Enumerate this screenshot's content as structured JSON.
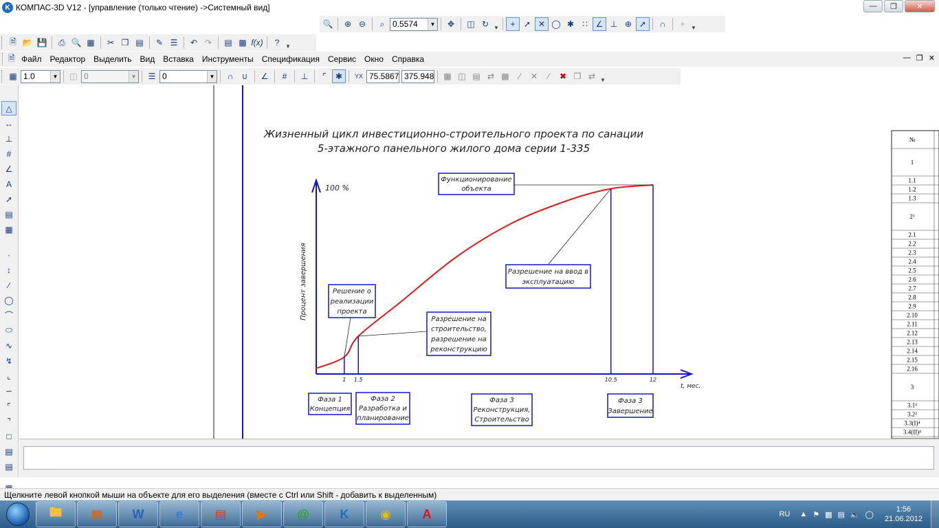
{
  "window": {
    "title": "КОМПАС-3D V12 - [управление (только чтение) ->Системный вид]",
    "controls": [
      "minimize-icon",
      "restore-icon",
      "close-icon"
    ]
  },
  "view_toolbar": {
    "zoom_value": "0.5574",
    "icons": [
      "zoom-window-icon",
      "zoom-in-icon",
      "zoom-out-icon",
      "zoom-scale-icon",
      "pan-icon",
      "refresh-icon",
      "redraw-icon"
    ]
  },
  "standard_toolbar": {
    "icons": [
      "new-file-icon",
      "open-file-icon",
      "save-icon",
      "print-icon",
      "print-preview-icon",
      "print-setup-icon",
      "cut-icon",
      "copy-icon",
      "paste-icon",
      "format-painter-icon",
      "properties-icon",
      "undo-icon",
      "redo-icon",
      "manager-icon",
      "library-icon",
      "variables-icon",
      "help-icon"
    ]
  },
  "menu": {
    "items": [
      "Файл",
      "Редактор",
      "Выделить",
      "Вид",
      "Вставка",
      "Инструменты",
      "Спецификация",
      "Сервис",
      "Окно",
      "Справка"
    ]
  },
  "current_params": {
    "scale_value": "1.0",
    "layer_value": "0",
    "style_value": "0",
    "coord_x": "75.5867",
    "coord_y": "375.948"
  },
  "drawing": {
    "title_line1": "Жизненный цикл инвестиционно-строительного проекта по санации",
    "title_line2": "5-этажного панельного жилого дома серии 1-335",
    "ylabel": "Процент завершения",
    "y_top_label": "100 %",
    "xlabel": "t, мес.",
    "x_ticks": [
      "1",
      "1.5",
      "10.5",
      "12"
    ],
    "callouts": [
      {
        "lines": [
          "Функционирование",
          "объекта"
        ]
      },
      {
        "lines": [
          "Решение о",
          "реализации",
          "проекта"
        ]
      },
      {
        "lines": [
          "Разрешение на",
          "строительство,",
          "разрешение на",
          "реконструкцию"
        ]
      },
      {
        "lines": [
          "Разрешение на ввод в",
          "эксплуатацию"
        ]
      }
    ],
    "phases": [
      {
        "lines": [
          "Фаза 1",
          "Концепция"
        ]
      },
      {
        "lines": [
          "Фаза 2",
          "Разработка и",
          "планирование"
        ]
      },
      {
        "lines": [
          "Фаза 3",
          "Реконструкция,",
          "Строительство"
        ]
      },
      {
        "lines": [
          "Фаза 3",
          "Завершение"
        ]
      }
    ],
    "curve_color": "#e01818",
    "frame_color": "#1414c8",
    "table_rows": [
      "№",
      "1",
      "1.1",
      "1.2",
      "1.3",
      "2¹",
      "2.1",
      "2.2",
      "2.3",
      "2.4",
      "2.5",
      "2.6",
      "2.7",
      "2.8",
      "2.9",
      "2.10",
      "2.11",
      "2.12",
      "2.13",
      "2.14",
      "2.15",
      "2.16",
      "3",
      "3.1²",
      "3.2²",
      "3.3(I)⁴",
      "3.4(II)²"
    ]
  },
  "chart_data": {
    "type": "line",
    "title": "Жизненный цикл инвестиционно-строительного проекта по санации 5-этажного панельного жилого дома серии 1-335",
    "xlabel": "t, мес.",
    "ylabel": "Процент завершения",
    "ylim": [
      0,
      100
    ],
    "series": [
      {
        "x": [
          0,
          1,
          1.5,
          3,
          5,
          7,
          9,
          10.5,
          12
        ],
        "y": [
          3,
          9,
          20,
          38,
          62,
          80,
          92,
          98,
          100
        ]
      }
    ]
  },
  "status": {
    "text": "Щелкните левой кнопкой мыши на объекте для его выделения (вместе с Ctrl или Shift - добавить к выделенным)"
  },
  "taskbar": {
    "apps": [
      "explorer-icon",
      "kompas-installer-icon",
      "word-icon",
      "ie-icon",
      "ppt-icon",
      "media-player-icon",
      "icq-icon",
      "kompas-icon",
      "chrome-icon",
      "avira-icon"
    ],
    "lang": "RU",
    "time": "1:56",
    "date": "21.06.2012"
  }
}
